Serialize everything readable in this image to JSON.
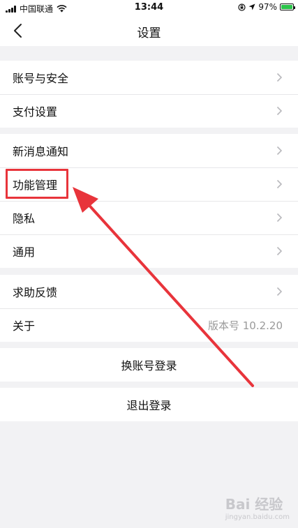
{
  "status_bar": {
    "carrier": "中国联通",
    "time": "13:44",
    "battery": "97%",
    "battery_level": 0.97
  },
  "nav": {
    "title": "设置",
    "back_icon": "chevron-left-icon"
  },
  "group1": [
    {
      "label": "账号与安全"
    },
    {
      "label": "支付设置"
    }
  ],
  "group2": [
    {
      "label": "新消息通知"
    },
    {
      "label": "功能管理"
    },
    {
      "label": "隐私"
    },
    {
      "label": "通用"
    }
  ],
  "group3": [
    {
      "label": "求助反馈"
    },
    {
      "label": "关于",
      "value": "版本号 10.2.20"
    }
  ],
  "buttons": {
    "switch_account": "换账号登录",
    "logout": "退出登录"
  },
  "watermark": {
    "text": "Bai 经验",
    "url": "jingyan.baidu.com"
  },
  "colors": {
    "accent": "#e8343b",
    "background": "#f2f2f4"
  }
}
